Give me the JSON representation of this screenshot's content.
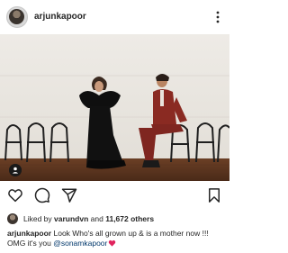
{
  "header": {
    "username": "arjunkapoor",
    "avatar_icon": "profile-avatar",
    "more_icon": "more-options-icon"
  },
  "post": {
    "tag_icon": "user-tag-icon"
  },
  "actions": {
    "like_icon": "heart-icon",
    "comment_icon": "comment-icon",
    "share_icon": "paper-plane-icon",
    "save_icon": "bookmark-icon"
  },
  "likes": {
    "prefix": "Liked by ",
    "user": "varundvn",
    "middle": " and ",
    "others": "11,672 others"
  },
  "caption": {
    "username": "arjunkapoor",
    "text_line1": " Look Who's all grown up & is a mother now !!!",
    "text_line2": "OMG it's you ",
    "mention": "@sonamkapoor",
    "emoji": "red-heart-emoji"
  },
  "colors": {
    "mention": "#00376b",
    "heart": "#e0245e"
  }
}
